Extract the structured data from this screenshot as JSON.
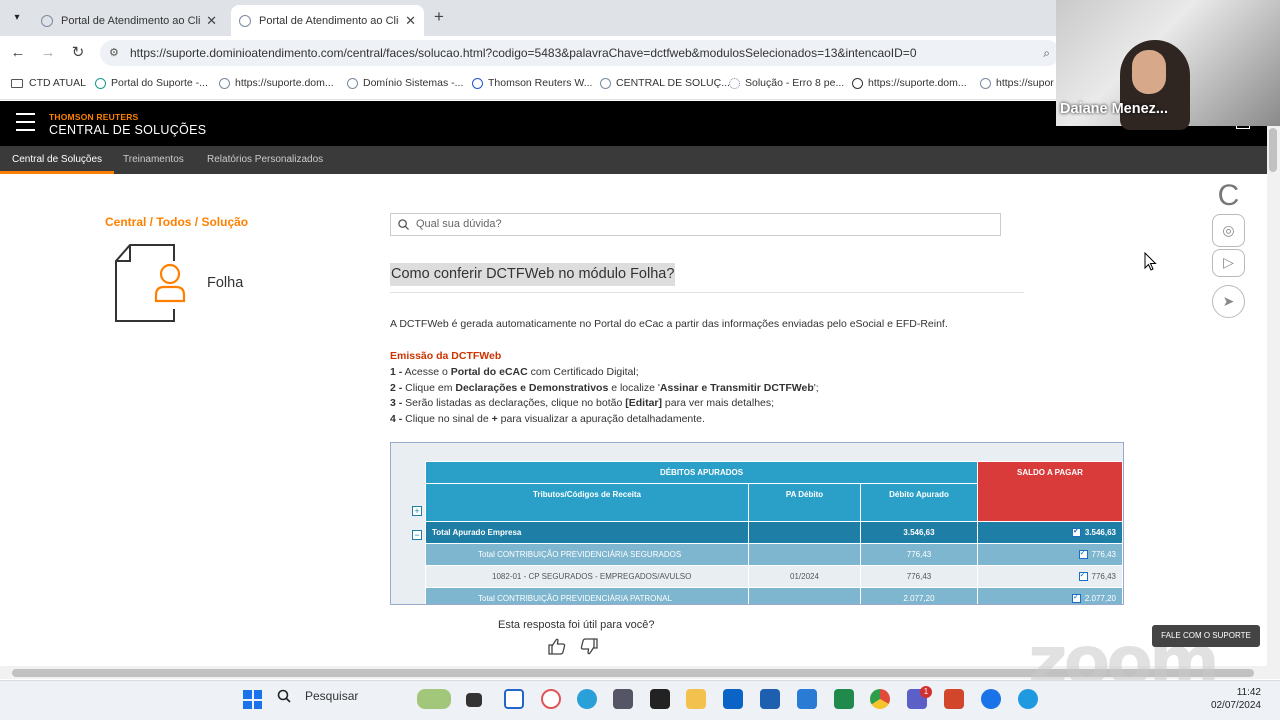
{
  "browser": {
    "tabs": [
      {
        "title": "Portal de Atendimento ao Clien",
        "active": false
      },
      {
        "title": "Portal de Atendimento ao Clien",
        "active": true
      }
    ],
    "new_tab": "+",
    "url": "https://suporte.dominioatendimento.com/central/faces/solucao.html?codigo=5483&palavraChave=dctfweb&modulosSelecionados=13&intencaoID=0",
    "bookmarks": [
      "CTD ATUAL",
      "Portal do Suporte -...",
      "https://suporte.dom...",
      "Domínio Sistemas -...",
      "Thomson Reuters W...",
      "CENTRAL DE SOLUÇ...",
      "Solução - Erro 8 pe...",
      "https://suporte.dom...",
      "https://supor"
    ]
  },
  "site": {
    "brand_top": "THOMSON REUTERS",
    "brand_bottom": "CENTRAL DE SOLUÇÕES",
    "subnav": [
      "Central de Soluções",
      "Treinamentos",
      "Relatórios Personalizados"
    ],
    "breadcrumb": "Central / Todos / Solução",
    "category": "Folha",
    "search_placeholder": "Qual sua dúvida?",
    "question_title": "Como conferir DCTFWeb no módulo Folha?",
    "intro": "A DCTFWeb é gerada automaticamente no Portal do eCac a partir das informações enviadas pelo eSocial e EFD-Reinf.",
    "section_title": "Emissão da DCTFWeb",
    "steps": [
      {
        "n": "1 -",
        "a": " Acesse o ",
        "b": "Portal do eCAC",
        "c": " com Certificado Digital;",
        "d": "",
        "e": ""
      },
      {
        "n": "2 -",
        "a": " Clique em ",
        "b": "Declarações e Demonstrativos",
        "c": " e localize '",
        "d": "Assinar e Transmitir DCTFWeb",
        "e": "';"
      },
      {
        "n": "3 -",
        "a": " Serão listadas as declarações, clique no botão ",
        "b": "[Editar]",
        "c": " para ver mais detalhes;",
        "d": "",
        "e": ""
      },
      {
        "n": "4 -",
        "a": " Clique no sinal de ",
        "b": "+",
        "c": " para visualizar a apuração detalhadamente.",
        "d": "",
        "e": ""
      }
    ]
  },
  "table": {
    "debitos_header": "DÉBITOS APURADOS",
    "saldo_header": "SALDO A PAGAR",
    "col1": "Tributos/Códigos de Receita",
    "col2": "PA Débito",
    "col3": "Débito Apurado",
    "rows": [
      {
        "label": "Total Apurado Empresa",
        "pa": "",
        "debito": "3.546,63",
        "saldo": "3.546,63"
      },
      {
        "label": "Total CONTRIBUIÇÃO PREVIDENCIÁRIA SEGURADOS",
        "pa": "",
        "debito": "776,43",
        "saldo": "776,43"
      },
      {
        "label": "1082-01 - CP SEGURADOS - EMPREGADOS/AVULSO",
        "pa": "01/2024",
        "debito": "776,43",
        "saldo": "776,43"
      },
      {
        "label": "Total CONTRIBUIÇÃO PREVIDENCIÁRIA PATRONAL",
        "pa": "",
        "debito": "2.077,20",
        "saldo": "2.077,20"
      }
    ]
  },
  "feedback": {
    "question": "Esta resposta foi útil para você?",
    "up_icon": "thumbs-up-icon",
    "down_icon": "thumbs-down-icon"
  },
  "video": {
    "participant": "Daiane Menez..."
  },
  "zoom": {
    "watermark": "zoom",
    "support_button": "FALE COM O SUPORTE"
  },
  "taskbar": {
    "search": "Pesquisar",
    "time": "11:42",
    "date": "02/07/2024",
    "badge": "1"
  }
}
